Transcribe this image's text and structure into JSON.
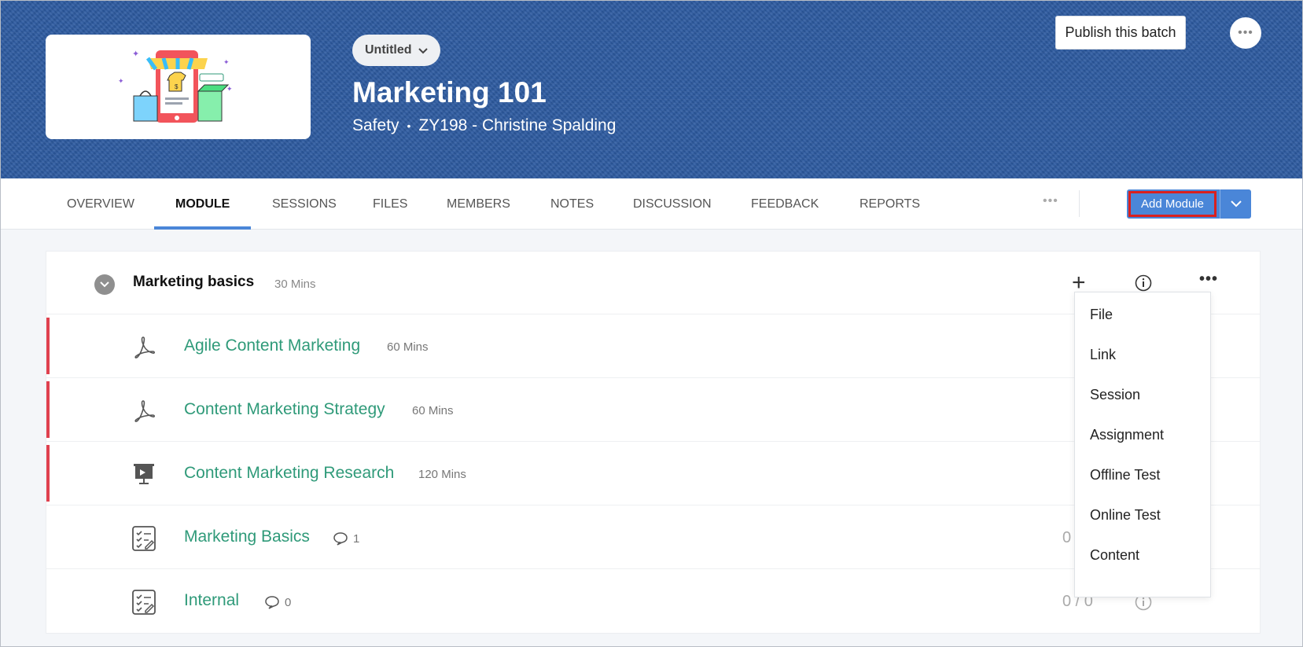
{
  "header": {
    "status_pill": "Untitled",
    "course_title": "Marketing 101",
    "category": "Safety",
    "batch": "ZY198 - Christine Spalding",
    "publish_label": "Publish this batch",
    "more_icon": "more-horizontal-icon",
    "thumbnail_icon": "shop-illustration"
  },
  "tabs": [
    {
      "label": "OVERVIEW"
    },
    {
      "label": "MODULE",
      "active": true
    },
    {
      "label": "SESSIONS"
    },
    {
      "label": "FILES"
    },
    {
      "label": "MEMBERS"
    },
    {
      "label": "NOTES"
    },
    {
      "label": "DISCUSSION"
    },
    {
      "label": "FEEDBACK"
    },
    {
      "label": "REPORTS"
    }
  ],
  "toolbar": {
    "add_module_label": "Add Module",
    "accent_color": "#4a86d8",
    "highlight_color": "#d9201f"
  },
  "module": {
    "title": "Marketing basics",
    "duration": "30 Mins",
    "items": [
      {
        "title": "Agile Content Marketing",
        "meta": "60 Mins",
        "icon": "pdf-icon",
        "marked": true
      },
      {
        "title": "Content Marketing Strategy",
        "meta": "60 Mins",
        "icon": "pdf-icon",
        "marked": true
      },
      {
        "title": "Content Marketing Research",
        "meta": "120 Mins",
        "icon": "presentation-icon",
        "marked": true
      },
      {
        "title": "Marketing Basics",
        "comments": "1",
        "score": "0",
        "icon": "assignment-icon",
        "marked": false
      },
      {
        "title": "Internal",
        "comments": "0",
        "score": "0 / 0",
        "icon": "assignment-icon",
        "marked": false
      }
    ]
  },
  "add_menu": {
    "items": [
      "File",
      "Link",
      "Session",
      "Assignment",
      "Offline Test",
      "Online Test",
      "Content"
    ]
  },
  "colors": {
    "banner": "#2c5aa0",
    "item_title": "#2f9a79",
    "row_marker": "#e0414f"
  }
}
